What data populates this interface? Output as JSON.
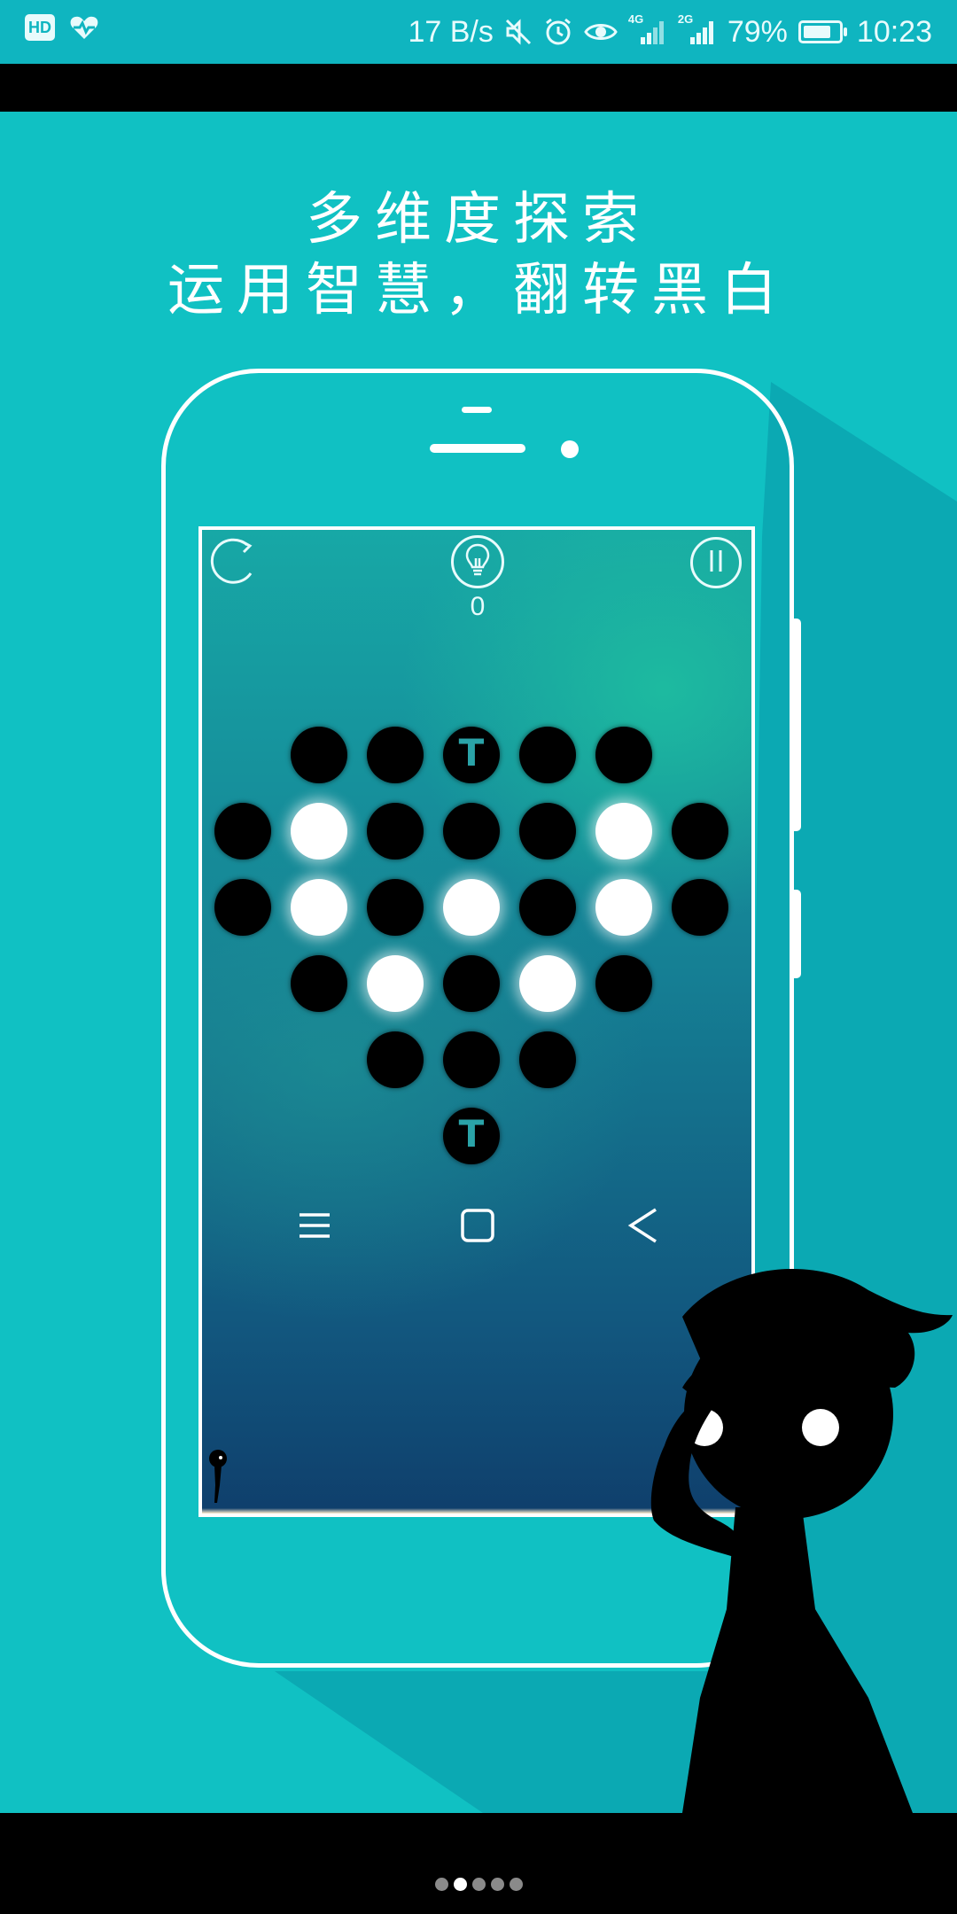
{
  "status_bar": {
    "speed": "17 B/s",
    "network_4g": "4G",
    "network_2g": "2G",
    "battery_text": "79%",
    "battery_level": 0.79,
    "time": "10:23",
    "icons": [
      "hd-icon",
      "health-heart-icon",
      "mute-icon",
      "alarm-icon",
      "eye-icon",
      "signal-4g-icon",
      "signal-2g-icon",
      "battery-icon"
    ],
    "color": "#0fb5c0"
  },
  "promo": {
    "headline_line1": "多维度探索",
    "headline_line2": "运用智慧，翻转黑白",
    "background_color": "#10c1c3"
  },
  "game": {
    "hint_count": "0",
    "icons": [
      "restart-icon",
      "lightbulb-icon",
      "pause-icon"
    ],
    "board": [
      [
        "",
        "B",
        "B",
        "T",
        "B",
        "B",
        ""
      ],
      [
        "B",
        "W",
        "B",
        "B",
        "B",
        "W",
        "B"
      ],
      [
        "B",
        "W",
        "B",
        "W",
        "B",
        "W",
        "B"
      ],
      [
        "",
        "B",
        "W",
        "B",
        "W",
        "B",
        ""
      ],
      [
        "",
        "",
        "B",
        "B",
        "B",
        "",
        ""
      ],
      [
        "",
        "",
        "",
        "T",
        "",
        "",
        ""
      ]
    ],
    "toggle_symbol": "T"
  },
  "phone_nav": {
    "icons": [
      "menu-icon",
      "home-square-icon",
      "back-chevron-icon"
    ]
  },
  "pager": {
    "count": 5,
    "active_index": 1
  }
}
